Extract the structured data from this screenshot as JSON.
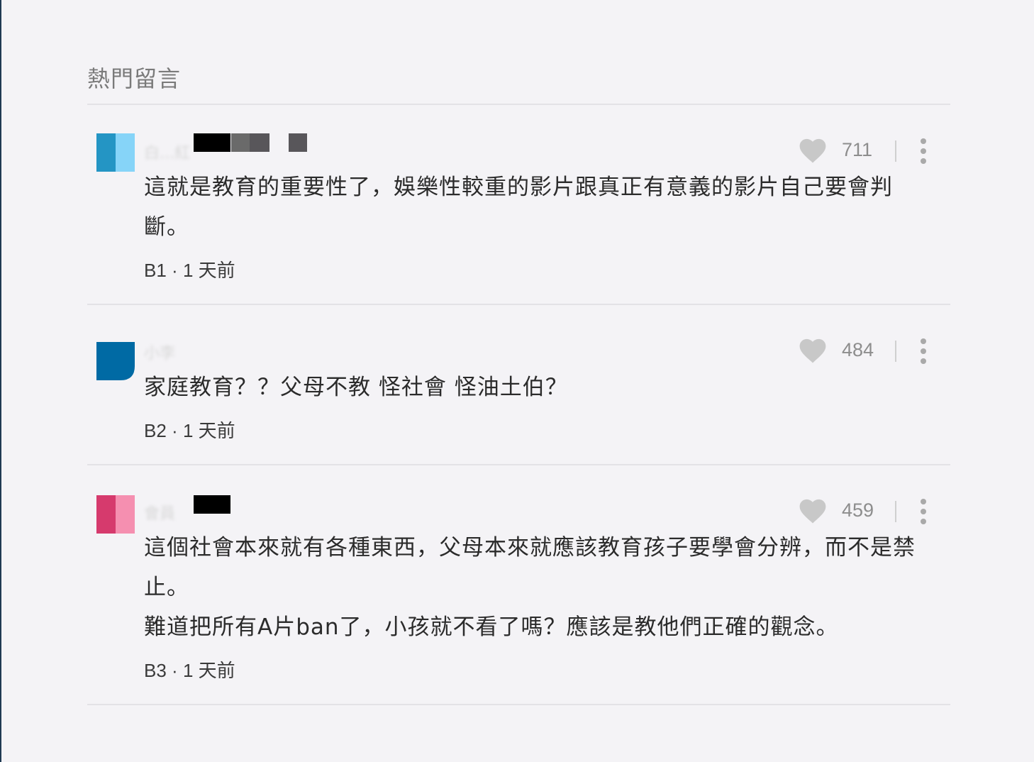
{
  "section": {
    "title": "熱門留言"
  },
  "comments": [
    {
      "username": "白...紅",
      "likes": "711",
      "lines": [
        "這就是教育的重要性了，娛樂性較重的影片跟真正有意義的影片自己要會判",
        "斷。"
      ],
      "floor": "B1",
      "dot": "·",
      "time": "1 天前",
      "avatar_colors": [
        "#2495c4",
        "#86d4f8"
      ]
    },
    {
      "username": "小李",
      "likes": "484",
      "lines": [
        "家庭教育？？父母不教 怪社會 怪油土伯？"
      ],
      "floor": "B2",
      "dot": "·",
      "time": "1 天前",
      "avatar_colors": [
        "#006aa4",
        "#006aa4"
      ]
    },
    {
      "username": "會員",
      "likes": "459",
      "lines": [
        "這個社會本來就有各種東西，父母本來就應該教育孩子要學會分辨，而不是禁",
        "止。",
        "難道把所有A片ban了，小孩就不看了嗎？應該是教他們正確的觀念。"
      ],
      "floor": "B3",
      "dot": "·",
      "time": "1 天前",
      "avatar_colors": [
        "#d63a6d",
        "#f58fb0"
      ]
    }
  ],
  "icons": {
    "like": "heart-icon",
    "more": "more-vertical-icon"
  }
}
